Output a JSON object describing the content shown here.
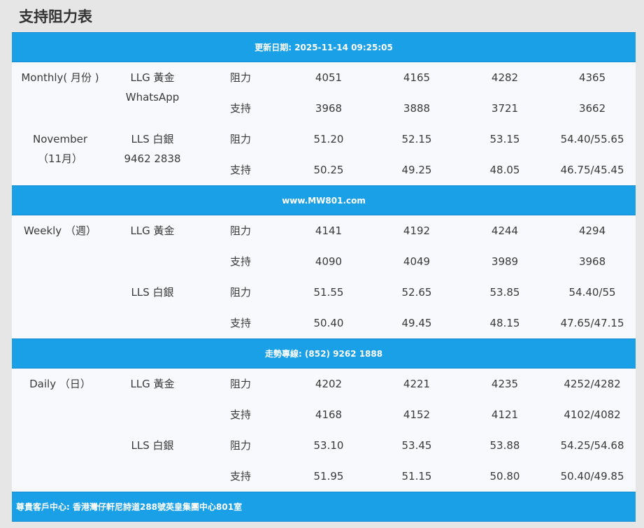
{
  "page_title": "支持阻力表",
  "banners": {
    "updated": "更新日期: 2025-11-14 09:25:05",
    "website": "www.MW801.com",
    "hotline": "走勢專線: (852) 9262 1888",
    "address": "尊貴客戶中心: 香港灣仔軒尼詩道288號英皇集團中心801室"
  },
  "monthly": {
    "period_line1": "Monthly( 月份 )",
    "period_line2": "November",
    "period_line3": "（11月）",
    "llg_label": "LLG 黃金",
    "llg_sub": "WhatsApp",
    "lls_label": "LLS 白銀",
    "lls_sub": "9462 2838",
    "llg_resist_label": "阻力",
    "llg_resist": [
      "4051",
      "4165",
      "4282",
      "4365"
    ],
    "llg_support_label": "支持",
    "llg_support": [
      "3968",
      "3888",
      "3721",
      "3662"
    ],
    "lls_resist_label": "阻力",
    "lls_resist": [
      "51.20",
      "52.15",
      "53.15",
      "54.40/55.65"
    ],
    "lls_support_label": "支持",
    "lls_support": [
      "50.25",
      "49.25",
      "48.05",
      "46.75/45.45"
    ]
  },
  "weekly": {
    "period": "Weekly （週）",
    "llg_label": "LLG 黃金",
    "lls_label": "LLS 白銀",
    "llg_resist_label": "阻力",
    "llg_resist": [
      "4141",
      "4192",
      "4244",
      "4294"
    ],
    "llg_support_label": "支持",
    "llg_support": [
      "4090",
      "4049",
      "3989",
      "3968"
    ],
    "lls_resist_label": "阻力",
    "lls_resist": [
      "51.55",
      "52.65",
      "53.85",
      "54.40/55"
    ],
    "lls_support_label": "支持",
    "lls_support": [
      "50.40",
      "49.45",
      "48.15",
      "47.65/47.15"
    ]
  },
  "daily": {
    "period": "Daily （日）",
    "llg_label": "LLG 黃金",
    "lls_label": "LLS 白銀",
    "llg_resist_label": "阻力",
    "llg_resist": [
      "4202",
      "4221",
      "4235",
      "4252/4282"
    ],
    "llg_support_label": "支持",
    "llg_support": [
      "4168",
      "4152",
      "4121",
      "4102/4082"
    ],
    "lls_resist_label": "阻力",
    "lls_resist": [
      "53.10",
      "53.45",
      "53.88",
      "54.25/54.68"
    ],
    "lls_support_label": "支持",
    "lls_support": [
      "51.95",
      "51.15",
      "50.80",
      "50.40/49.85"
    ]
  },
  "colors": {
    "banner": "#1aa0e6",
    "panel": "#f7f9fc",
    "page": "#e6e6e6"
  }
}
